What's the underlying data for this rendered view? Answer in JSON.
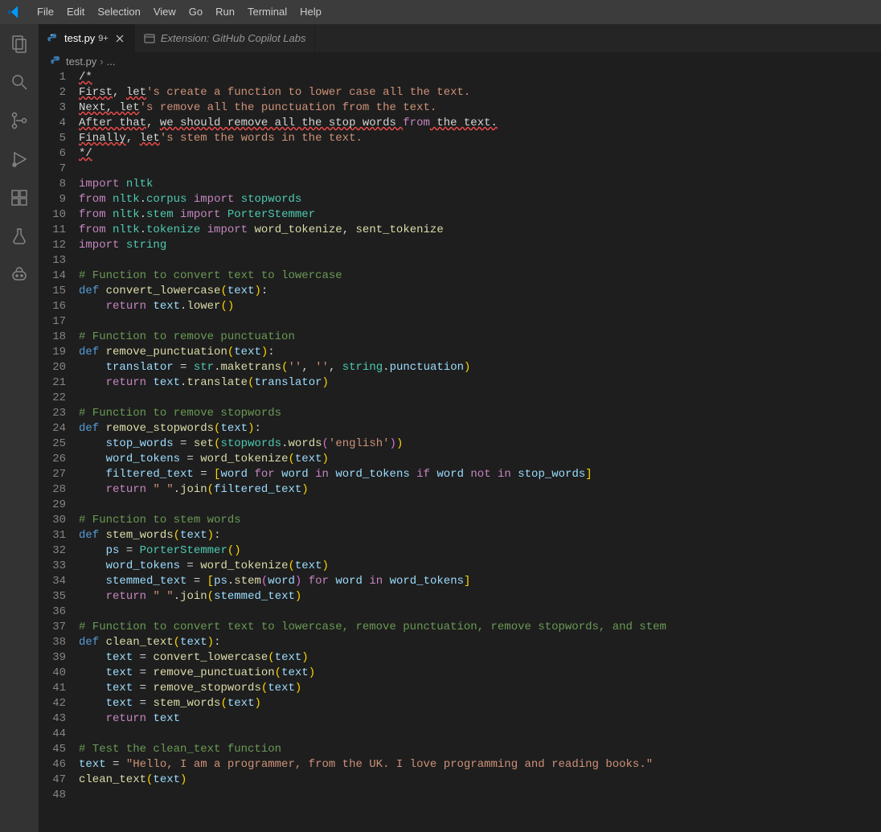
{
  "menu": {
    "items": [
      "File",
      "Edit",
      "Selection",
      "View",
      "Go",
      "Run",
      "Terminal",
      "Help"
    ]
  },
  "tabs": [
    {
      "label": "test.py",
      "dirty": "9+",
      "active": true,
      "closeable": true,
      "icon": "python-icon"
    },
    {
      "label": "Extension: GitHub Copilot Labs",
      "dirty": "",
      "active": false,
      "closeable": false,
      "icon": "preview-icon"
    }
  ],
  "breadcrumbs": {
    "file": "test.py",
    "tail": "..."
  },
  "activitybar": [
    {
      "name": "explorer-icon"
    },
    {
      "name": "search-icon"
    },
    {
      "name": "source-control-icon"
    },
    {
      "name": "run-debug-icon"
    },
    {
      "name": "extensions-icon"
    },
    {
      "name": "testing-icon"
    },
    {
      "name": "copilot-icon"
    }
  ],
  "code": {
    "lines": [
      [
        {
          "c": "errline",
          "t": "/*"
        }
      ],
      [
        {
          "c": "errline",
          "t": "First"
        },
        {
          "c": "punc",
          "t": ", "
        },
        {
          "c": "errline",
          "t": "let"
        },
        {
          "c": "str",
          "t": "'s create a function to lower case all the text."
        }
      ],
      [
        {
          "c": "errline",
          "t": "Next, let"
        },
        {
          "c": "str",
          "t": "'s remove all the punctuation from the text."
        }
      ],
      [
        {
          "c": "errline",
          "t": "After that"
        },
        {
          "c": "punc",
          "t": ", "
        },
        {
          "c": "errline",
          "t": "we should remove all the stop words "
        },
        {
          "c": "kw",
          "t": "from"
        },
        {
          "c": "errline",
          "t": " the text."
        }
      ],
      [
        {
          "c": "errline",
          "t": "Finally"
        },
        {
          "c": "punc",
          "t": ", "
        },
        {
          "c": "errline",
          "t": "let"
        },
        {
          "c": "str",
          "t": "'s stem the words in the text."
        }
      ],
      [
        {
          "c": "errline",
          "t": "*/"
        }
      ],
      [
        {
          "c": "",
          "t": ""
        }
      ],
      [
        {
          "c": "kw",
          "t": "import"
        },
        {
          "c": "",
          "t": " "
        },
        {
          "c": "mod",
          "t": "nltk"
        }
      ],
      [
        {
          "c": "kw",
          "t": "from"
        },
        {
          "c": "",
          "t": " "
        },
        {
          "c": "mod",
          "t": "nltk"
        },
        {
          "c": "punc",
          "t": "."
        },
        {
          "c": "mod",
          "t": "corpus"
        },
        {
          "c": "",
          "t": " "
        },
        {
          "c": "kw",
          "t": "import"
        },
        {
          "c": "",
          "t": " "
        },
        {
          "c": "mod",
          "t": "stopwords"
        }
      ],
      [
        {
          "c": "kw",
          "t": "from"
        },
        {
          "c": "",
          "t": " "
        },
        {
          "c": "mod",
          "t": "nltk"
        },
        {
          "c": "punc",
          "t": "."
        },
        {
          "c": "mod",
          "t": "stem"
        },
        {
          "c": "",
          "t": " "
        },
        {
          "c": "kw",
          "t": "import"
        },
        {
          "c": "",
          "t": " "
        },
        {
          "c": "mod",
          "t": "PorterStemmer"
        }
      ],
      [
        {
          "c": "kw",
          "t": "from"
        },
        {
          "c": "",
          "t": " "
        },
        {
          "c": "mod",
          "t": "nltk"
        },
        {
          "c": "punc",
          "t": "."
        },
        {
          "c": "mod",
          "t": "tokenize"
        },
        {
          "c": "",
          "t": " "
        },
        {
          "c": "kw",
          "t": "import"
        },
        {
          "c": "",
          "t": " "
        },
        {
          "c": "fn",
          "t": "word_tokenize"
        },
        {
          "c": "punc",
          "t": ", "
        },
        {
          "c": "fn",
          "t": "sent_tokenize"
        }
      ],
      [
        {
          "c": "kw",
          "t": "import"
        },
        {
          "c": "",
          "t": " "
        },
        {
          "c": "mod",
          "t": "string"
        }
      ],
      [
        {
          "c": "",
          "t": ""
        }
      ],
      [
        {
          "c": "cm",
          "t": "# Function to convert text to lowercase"
        }
      ],
      [
        {
          "c": "bf",
          "t": "def"
        },
        {
          "c": "",
          "t": " "
        },
        {
          "c": "fn",
          "t": "convert_lowercase"
        },
        {
          "c": "paren",
          "t": "("
        },
        {
          "c": "var",
          "t": "text"
        },
        {
          "c": "paren",
          "t": ")"
        },
        {
          "c": "punc",
          "t": ":"
        }
      ],
      [
        {
          "c": "",
          "t": "    "
        },
        {
          "c": "kw",
          "t": "return"
        },
        {
          "c": "",
          "t": " "
        },
        {
          "c": "var",
          "t": "text"
        },
        {
          "c": "punc",
          "t": "."
        },
        {
          "c": "fn",
          "t": "lower"
        },
        {
          "c": "paren",
          "t": "()"
        }
      ],
      [
        {
          "c": "",
          "t": ""
        }
      ],
      [
        {
          "c": "cm",
          "t": "# Function to remove punctuation"
        }
      ],
      [
        {
          "c": "bf",
          "t": "def"
        },
        {
          "c": "",
          "t": " "
        },
        {
          "c": "fn",
          "t": "remove_punctuation"
        },
        {
          "c": "paren",
          "t": "("
        },
        {
          "c": "var",
          "t": "text"
        },
        {
          "c": "paren",
          "t": ")"
        },
        {
          "c": "punc",
          "t": ":"
        }
      ],
      [
        {
          "c": "",
          "t": "    "
        },
        {
          "c": "var",
          "t": "translator"
        },
        {
          "c": "",
          "t": " = "
        },
        {
          "c": "mod",
          "t": "str"
        },
        {
          "c": "punc",
          "t": "."
        },
        {
          "c": "fn",
          "t": "maketrans"
        },
        {
          "c": "paren",
          "t": "("
        },
        {
          "c": "str",
          "t": "''"
        },
        {
          "c": "punc",
          "t": ", "
        },
        {
          "c": "str",
          "t": "''"
        },
        {
          "c": "punc",
          "t": ", "
        },
        {
          "c": "mod",
          "t": "string"
        },
        {
          "c": "punc",
          "t": "."
        },
        {
          "c": "var",
          "t": "punctuation"
        },
        {
          "c": "paren",
          "t": ")"
        }
      ],
      [
        {
          "c": "",
          "t": "    "
        },
        {
          "c": "kw",
          "t": "return"
        },
        {
          "c": "",
          "t": " "
        },
        {
          "c": "var",
          "t": "text"
        },
        {
          "c": "punc",
          "t": "."
        },
        {
          "c": "fn",
          "t": "translate"
        },
        {
          "c": "paren",
          "t": "("
        },
        {
          "c": "var",
          "t": "translator"
        },
        {
          "c": "paren",
          "t": ")"
        }
      ],
      [
        {
          "c": "",
          "t": ""
        }
      ],
      [
        {
          "c": "cm",
          "t": "# Function to remove stopwords"
        }
      ],
      [
        {
          "c": "bf",
          "t": "def"
        },
        {
          "c": "",
          "t": " "
        },
        {
          "c": "fn",
          "t": "remove_stopwords"
        },
        {
          "c": "paren",
          "t": "("
        },
        {
          "c": "var",
          "t": "text"
        },
        {
          "c": "paren",
          "t": ")"
        },
        {
          "c": "punc",
          "t": ":"
        }
      ],
      [
        {
          "c": "",
          "t": "    "
        },
        {
          "c": "var",
          "t": "stop_words"
        },
        {
          "c": "",
          "t": " = "
        },
        {
          "c": "fn",
          "t": "set"
        },
        {
          "c": "paren",
          "t": "("
        },
        {
          "c": "mod",
          "t": "stopwords"
        },
        {
          "c": "punc",
          "t": "."
        },
        {
          "c": "fn",
          "t": "words"
        },
        {
          "c": "paren2",
          "t": "("
        },
        {
          "c": "str",
          "t": "'english'"
        },
        {
          "c": "paren2",
          "t": ")"
        },
        {
          "c": "paren",
          "t": ")"
        }
      ],
      [
        {
          "c": "",
          "t": "    "
        },
        {
          "c": "var",
          "t": "word_tokens"
        },
        {
          "c": "",
          "t": " = "
        },
        {
          "c": "fn",
          "t": "word_tokenize"
        },
        {
          "c": "paren",
          "t": "("
        },
        {
          "c": "var",
          "t": "text"
        },
        {
          "c": "paren",
          "t": ")"
        }
      ],
      [
        {
          "c": "",
          "t": "    "
        },
        {
          "c": "var",
          "t": "filtered_text"
        },
        {
          "c": "",
          "t": " = "
        },
        {
          "c": "paren",
          "t": "["
        },
        {
          "c": "var",
          "t": "word"
        },
        {
          "c": "",
          "t": " "
        },
        {
          "c": "kw",
          "t": "for"
        },
        {
          "c": "",
          "t": " "
        },
        {
          "c": "var",
          "t": "word"
        },
        {
          "c": "",
          "t": " "
        },
        {
          "c": "kw",
          "t": "in"
        },
        {
          "c": "",
          "t": " "
        },
        {
          "c": "var",
          "t": "word_tokens"
        },
        {
          "c": "",
          "t": " "
        },
        {
          "c": "kw",
          "t": "if"
        },
        {
          "c": "",
          "t": " "
        },
        {
          "c": "var",
          "t": "word"
        },
        {
          "c": "",
          "t": " "
        },
        {
          "c": "kw",
          "t": "not"
        },
        {
          "c": "",
          "t": " "
        },
        {
          "c": "kw",
          "t": "in"
        },
        {
          "c": "",
          "t": " "
        },
        {
          "c": "var",
          "t": "stop_words"
        },
        {
          "c": "paren",
          "t": "]"
        }
      ],
      [
        {
          "c": "",
          "t": "    "
        },
        {
          "c": "kw",
          "t": "return"
        },
        {
          "c": "",
          "t": " "
        },
        {
          "c": "str",
          "t": "\" \""
        },
        {
          "c": "punc",
          "t": "."
        },
        {
          "c": "fn",
          "t": "join"
        },
        {
          "c": "paren",
          "t": "("
        },
        {
          "c": "var",
          "t": "filtered_text"
        },
        {
          "c": "paren",
          "t": ")"
        }
      ],
      [
        {
          "c": "",
          "t": ""
        }
      ],
      [
        {
          "c": "cm",
          "t": "# Function to stem words"
        }
      ],
      [
        {
          "c": "bf",
          "t": "def"
        },
        {
          "c": "",
          "t": " "
        },
        {
          "c": "fn",
          "t": "stem_words"
        },
        {
          "c": "paren",
          "t": "("
        },
        {
          "c": "var",
          "t": "text"
        },
        {
          "c": "paren",
          "t": ")"
        },
        {
          "c": "punc",
          "t": ":"
        }
      ],
      [
        {
          "c": "",
          "t": "    "
        },
        {
          "c": "var",
          "t": "ps"
        },
        {
          "c": "",
          "t": " = "
        },
        {
          "c": "mod",
          "t": "PorterStemmer"
        },
        {
          "c": "paren",
          "t": "()"
        }
      ],
      [
        {
          "c": "",
          "t": "    "
        },
        {
          "c": "var",
          "t": "word_tokens"
        },
        {
          "c": "",
          "t": " = "
        },
        {
          "c": "fn",
          "t": "word_tokenize"
        },
        {
          "c": "paren",
          "t": "("
        },
        {
          "c": "var",
          "t": "text"
        },
        {
          "c": "paren",
          "t": ")"
        }
      ],
      [
        {
          "c": "",
          "t": "    "
        },
        {
          "c": "var",
          "t": "stemmed_text"
        },
        {
          "c": "",
          "t": " = "
        },
        {
          "c": "paren",
          "t": "["
        },
        {
          "c": "var",
          "t": "ps"
        },
        {
          "c": "punc",
          "t": "."
        },
        {
          "c": "fn",
          "t": "stem"
        },
        {
          "c": "paren2",
          "t": "("
        },
        {
          "c": "var",
          "t": "word"
        },
        {
          "c": "paren2",
          "t": ")"
        },
        {
          "c": "",
          "t": " "
        },
        {
          "c": "kw",
          "t": "for"
        },
        {
          "c": "",
          "t": " "
        },
        {
          "c": "var",
          "t": "word"
        },
        {
          "c": "",
          "t": " "
        },
        {
          "c": "kw",
          "t": "in"
        },
        {
          "c": "",
          "t": " "
        },
        {
          "c": "var",
          "t": "word_tokens"
        },
        {
          "c": "paren",
          "t": "]"
        }
      ],
      [
        {
          "c": "",
          "t": "    "
        },
        {
          "c": "kw",
          "t": "return"
        },
        {
          "c": "",
          "t": " "
        },
        {
          "c": "str",
          "t": "\" \""
        },
        {
          "c": "punc",
          "t": "."
        },
        {
          "c": "fn",
          "t": "join"
        },
        {
          "c": "paren",
          "t": "("
        },
        {
          "c": "var",
          "t": "stemmed_text"
        },
        {
          "c": "paren",
          "t": ")"
        }
      ],
      [
        {
          "c": "",
          "t": ""
        }
      ],
      [
        {
          "c": "cm",
          "t": "# Function to convert text to lowercase, remove punctuation, remove stopwords, and stem"
        }
      ],
      [
        {
          "c": "bf",
          "t": "def"
        },
        {
          "c": "",
          "t": " "
        },
        {
          "c": "fn",
          "t": "clean_text"
        },
        {
          "c": "paren",
          "t": "("
        },
        {
          "c": "var",
          "t": "text"
        },
        {
          "c": "paren",
          "t": ")"
        },
        {
          "c": "punc",
          "t": ":"
        }
      ],
      [
        {
          "c": "",
          "t": "    "
        },
        {
          "c": "var",
          "t": "text"
        },
        {
          "c": "",
          "t": " = "
        },
        {
          "c": "fn",
          "t": "convert_lowercase"
        },
        {
          "c": "paren",
          "t": "("
        },
        {
          "c": "var",
          "t": "text"
        },
        {
          "c": "paren",
          "t": ")"
        }
      ],
      [
        {
          "c": "",
          "t": "    "
        },
        {
          "c": "var",
          "t": "text"
        },
        {
          "c": "",
          "t": " = "
        },
        {
          "c": "fn",
          "t": "remove_punctuation"
        },
        {
          "c": "paren",
          "t": "("
        },
        {
          "c": "var",
          "t": "text"
        },
        {
          "c": "paren",
          "t": ")"
        }
      ],
      [
        {
          "c": "",
          "t": "    "
        },
        {
          "c": "var",
          "t": "text"
        },
        {
          "c": "",
          "t": " = "
        },
        {
          "c": "fn",
          "t": "remove_stopwords"
        },
        {
          "c": "paren",
          "t": "("
        },
        {
          "c": "var",
          "t": "text"
        },
        {
          "c": "paren",
          "t": ")"
        }
      ],
      [
        {
          "c": "",
          "t": "    "
        },
        {
          "c": "var",
          "t": "text"
        },
        {
          "c": "",
          "t": " = "
        },
        {
          "c": "fn",
          "t": "stem_words"
        },
        {
          "c": "paren",
          "t": "("
        },
        {
          "c": "var",
          "t": "text"
        },
        {
          "c": "paren",
          "t": ")"
        }
      ],
      [
        {
          "c": "",
          "t": "    "
        },
        {
          "c": "kw",
          "t": "return"
        },
        {
          "c": "",
          "t": " "
        },
        {
          "c": "var",
          "t": "text"
        }
      ],
      [
        {
          "c": "",
          "t": ""
        }
      ],
      [
        {
          "c": "cm",
          "t": "# Test the clean_text function"
        }
      ],
      [
        {
          "c": "var",
          "t": "text"
        },
        {
          "c": "",
          "t": " = "
        },
        {
          "c": "str",
          "t": "\"Hello, I am a programmer, from the UK. I love programming and reading books.\""
        }
      ],
      [
        {
          "c": "fn",
          "t": "clean_text"
        },
        {
          "c": "paren",
          "t": "("
        },
        {
          "c": "var",
          "t": "text"
        },
        {
          "c": "paren",
          "t": ")"
        }
      ],
      [
        {
          "c": "",
          "t": ""
        }
      ]
    ]
  }
}
